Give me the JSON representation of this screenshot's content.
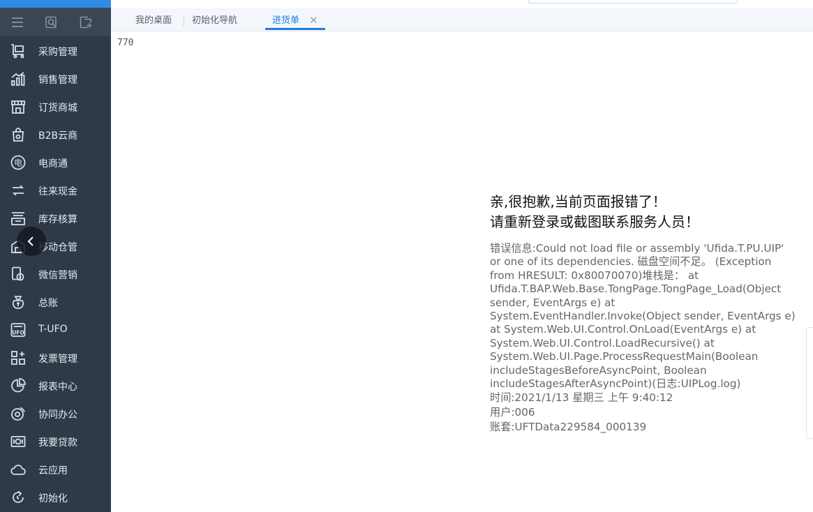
{
  "sidebar": {
    "tools": [
      {
        "icon": "menu-icon"
      },
      {
        "icon": "search-doc-icon"
      },
      {
        "icon": "add-doc-icon"
      }
    ],
    "items": [
      {
        "label": "采购管理",
        "icon": "purchase-cart-icon"
      },
      {
        "label": "销售管理",
        "icon": "sales-chart-icon"
      },
      {
        "label": "订货商城",
        "icon": "store-icon"
      },
      {
        "label": "B2B云商",
        "icon": "b2b-bag-icon"
      },
      {
        "label": "电商通",
        "icon": "ecommerce-icon"
      },
      {
        "label": "往来现金",
        "icon": "exchange-icon"
      },
      {
        "label": "库存核算",
        "icon": "inventory-icon"
      },
      {
        "label": "移动仓管",
        "icon": "mobile-warehouse-icon"
      },
      {
        "label": "微信营销",
        "icon": "wechat-marketing-icon"
      },
      {
        "label": "总账",
        "icon": "ledger-icon"
      },
      {
        "label": "T-UFO",
        "icon": "ufo-icon"
      },
      {
        "label": "发票管理",
        "icon": "invoice-grid-icon"
      },
      {
        "label": "报表中心",
        "icon": "report-pie-icon"
      },
      {
        "label": "协同办公",
        "icon": "collaboration-icon"
      },
      {
        "label": "我要贷款",
        "icon": "loan-icon"
      },
      {
        "label": "云应用",
        "icon": "cloud-icon"
      },
      {
        "label": "初始化",
        "icon": "init-refresh-icon"
      }
    ]
  },
  "tabs": [
    {
      "label": "我的桌面",
      "active": false
    },
    {
      "label": "初始化导航",
      "active": false
    },
    {
      "label": "进货单",
      "active": true,
      "close": "✕"
    }
  ],
  "content": {
    "count": "770",
    "error": {
      "title1": "亲,很抱歉,当前页面报错了！",
      "title2": "请重新登录或截图联系服务人员！",
      "message": "错误信息:Could not load file or assembly 'Ufida.T.PU.UIP' or one of its dependencies. 磁盘空间不足。 (Exception from HRESULT: 0x80070070)堆栈是： at Ufida.T.BAP.Web.Base.TongPage.TongPage_Load(Object sender, EventArgs e) at System.EventHandler.Invoke(Object sender, EventArgs e) at System.Web.UI.Control.OnLoad(EventArgs e) at System.Web.UI.Control.LoadRecursive() at System.Web.UI.Page.ProcessRequestMain(Boolean includeStagesBeforeAsyncPoint, Boolean includeStagesAfterAsyncPoint)(日志:UIPLog.log)",
      "time": "时间:2021/1/13 星期三 上午 9:40:12",
      "user": "用户:006",
      "account": "账套:UFTData229584_000139"
    }
  },
  "colors": {
    "sidebar_bg": "#2e3a48",
    "accent": "#1e7ee6",
    "tab_bar_bg": "#f3f6fa"
  }
}
